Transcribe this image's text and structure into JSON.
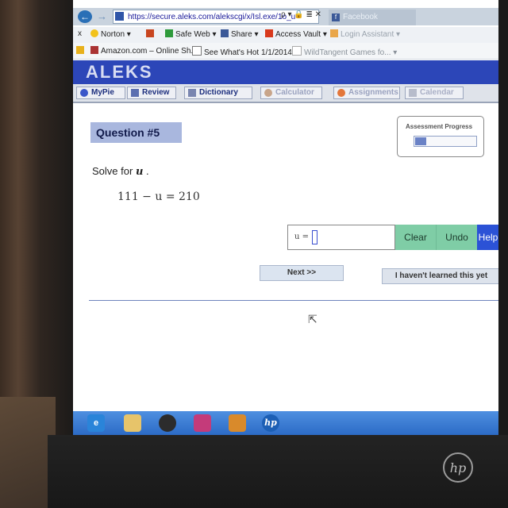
{
  "browser": {
    "url": "https://secure.aleks.com/alekscgi/x/Isl.exe/1o_u",
    "url_tools": "ρ ▾ 🔒 ≣ ✕",
    "tab_title": "Facebook"
  },
  "toolbar1": {
    "close": "x",
    "norton": "Norton ▾",
    "safe_web": "Safe Web ▾",
    "share": "Share ▾",
    "access_vault": "Access Vault ▾",
    "login_assistant": "Login Assistant ▾"
  },
  "toolbar2": {
    "fav1": "Amazon.com – Online Sh...",
    "fav2": "See What's Hot 1/1/2014 ▾",
    "fav3": "WildTangent Games fo... ▾"
  },
  "aleks": {
    "logo": "ALEKS",
    "nav": [
      "MyPie",
      "Review",
      "Dictionary",
      "Calculator",
      "Assignments",
      "Calendar"
    ]
  },
  "question": {
    "title": "Question #5",
    "prompt": "Solve for",
    "variable": "u",
    "period": ".",
    "equation": "111 − u = 210",
    "answer_lhs": "u =",
    "answer_value": ""
  },
  "progress": {
    "label": "Assessment Progress",
    "fraction": 0.18
  },
  "buttons": {
    "clear": "Clear",
    "undo": "Undo",
    "help": "Help",
    "next": "Next >>",
    "not_learned": "I haven't learned this yet"
  },
  "laptop": {
    "brand": "hp"
  },
  "taskbar": {
    "icons": [
      "ie-icon",
      "explorer-icon",
      "media-player-icon",
      "presentation-icon",
      "paint-icon",
      "hp-icon"
    ],
    "hp_label": "hp"
  },
  "colors": {
    "aleks_blue": "#2c46b8",
    "question_label_bg": "#a9b7de",
    "answer_buttons": "#7fcda6",
    "help_button": "#2b52d6",
    "taskbar": "#3a7dd6"
  }
}
